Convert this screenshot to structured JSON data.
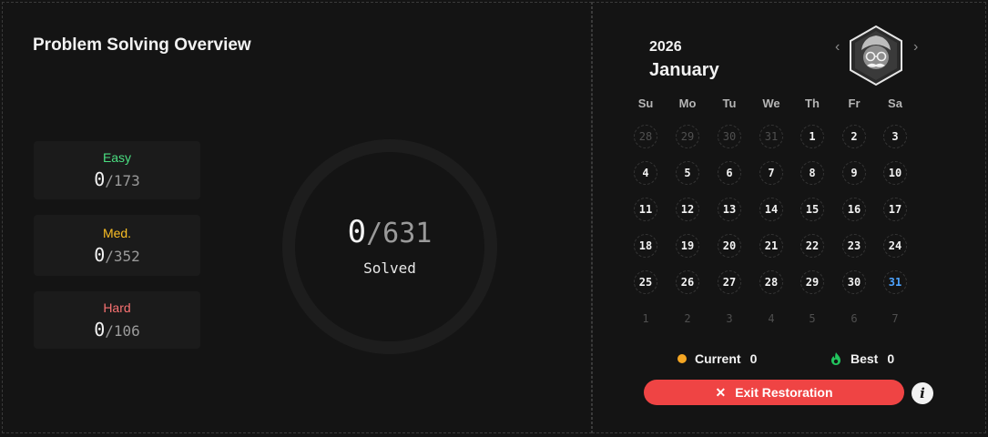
{
  "overview": {
    "title": "Problem Solving Overview",
    "easy": {
      "label": "Easy",
      "solved": "0",
      "total": "/173",
      "color": "#4ade80"
    },
    "medium": {
      "label": "Med.",
      "solved": "0",
      "total": "/352",
      "color": "#fbbf24"
    },
    "hard": {
      "label": "Hard",
      "solved": "0",
      "total": "/106",
      "color": "#f87171"
    },
    "ring": {
      "solved": "0",
      "total": "/631",
      "label": "Solved"
    }
  },
  "calendar": {
    "year": "2026",
    "month": "January",
    "prev_icon": "‹",
    "next_icon": "›",
    "avatar_icon": "guru-avatar-icon",
    "weekdays": [
      "Su",
      "Mo",
      "Tu",
      "We",
      "Th",
      "Fr",
      "Sa"
    ],
    "days": [
      [
        "28",
        "29",
        "30",
        "31",
        "1",
        "2",
        "3"
      ],
      [
        "4",
        "5",
        "6",
        "7",
        "8",
        "9",
        "10"
      ],
      [
        "11",
        "12",
        "13",
        "14",
        "15",
        "16",
        "17"
      ],
      [
        "18",
        "19",
        "20",
        "21",
        "22",
        "23",
        "24"
      ],
      [
        "25",
        "26",
        "27",
        "28",
        "29",
        "30",
        "31"
      ],
      [
        "1",
        "2",
        "3",
        "4",
        "5",
        "6",
        "7"
      ]
    ],
    "today": "31",
    "today_color": "#4da3ff"
  },
  "streak": {
    "current_label": "Current",
    "current_value": "0",
    "best_label": "Best",
    "best_value": "0"
  },
  "actions": {
    "exit_label": "Exit Restoration",
    "exit_icon": "✕",
    "info_icon": "i",
    "exit_color": "#ef4444"
  }
}
